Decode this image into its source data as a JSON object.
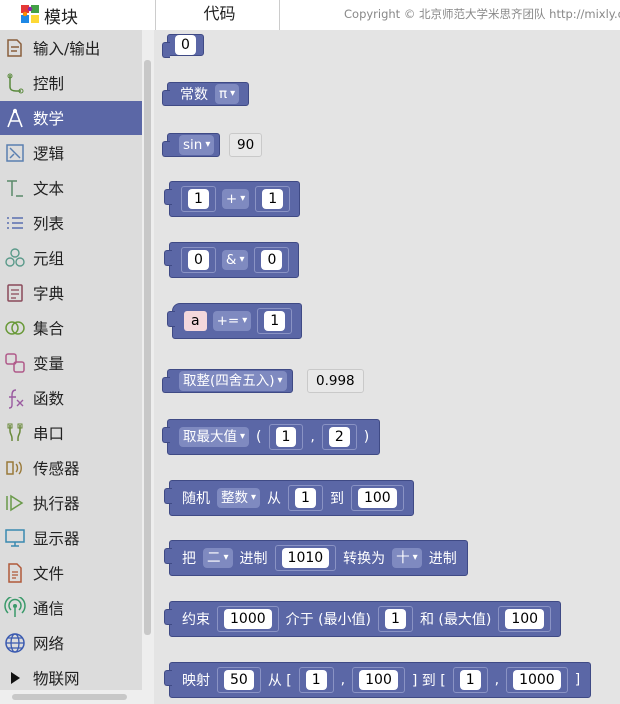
{
  "header": {
    "toolbox_title": "模块",
    "code_tab": "代码",
    "copyright": "Copyright © 北京师范大学米思齐团队 http://mixly.org"
  },
  "sidebar": {
    "items": [
      {
        "label": "输入/输出",
        "icon": "io-icon",
        "color": "#8a5e3c"
      },
      {
        "label": "控制",
        "icon": "control-icon",
        "color": "#5a8a3c"
      },
      {
        "label": "数学",
        "icon": "math-icon",
        "color": "#ffffff",
        "selected": true
      },
      {
        "label": "逻辑",
        "icon": "logic-icon",
        "color": "#5a7fb0"
      },
      {
        "label": "文本",
        "icon": "text-icon",
        "color": "#5a8a6a"
      },
      {
        "label": "列表",
        "icon": "list-icon",
        "color": "#5a6fb0"
      },
      {
        "label": "元组",
        "icon": "tuple-icon",
        "color": "#5a9a8a"
      },
      {
        "label": "字典",
        "icon": "dict-icon",
        "color": "#8a4a5a"
      },
      {
        "label": "集合",
        "icon": "set-icon",
        "color": "#6a9a3a"
      },
      {
        "label": "变量",
        "icon": "variable-icon",
        "color": "#b05a8a"
      },
      {
        "label": "函数",
        "icon": "function-icon",
        "color": "#9a5aa0"
      },
      {
        "label": "串口",
        "icon": "serial-icon",
        "color": "#6a8a3a"
      },
      {
        "label": "传感器",
        "icon": "sensor-icon",
        "color": "#9a7a3a"
      },
      {
        "label": "执行器",
        "icon": "actuator-icon",
        "color": "#6a9a4a"
      },
      {
        "label": "显示器",
        "icon": "display-icon",
        "color": "#3a8ab0"
      },
      {
        "label": "文件",
        "icon": "file-icon",
        "color": "#b05a3a"
      },
      {
        "label": "通信",
        "icon": "comm-icon",
        "color": "#3a9a6a"
      },
      {
        "label": "网络",
        "icon": "network-icon",
        "color": "#3a5ab0"
      },
      {
        "label": "物联网",
        "icon": "iot-icon",
        "color": "#111111"
      }
    ]
  },
  "blocks": {
    "number": {
      "value": "0"
    },
    "constant": {
      "label": "常数",
      "option": "π"
    },
    "trig": {
      "func": "sin",
      "value": "90"
    },
    "arith": {
      "a": "1",
      "op": "+",
      "b": "1"
    },
    "bitwise": {
      "a": "0",
      "op": "&",
      "b": "0"
    },
    "assign": {
      "var": "a",
      "op": "+=",
      "value": "1"
    },
    "round": {
      "func": "取整(四舍五入)",
      "value": "0.998"
    },
    "maxmin": {
      "func": "取最大值",
      "open": "(",
      "a": "1",
      "comma": ",",
      "b": "2",
      "close": ")"
    },
    "random": {
      "label": "随机",
      "type": "整数",
      "from": "从",
      "a": "1",
      "to": "到",
      "b": "100"
    },
    "radix": {
      "label": "把",
      "from_base": "二",
      "jinzhi1": "进制",
      "value": "1010",
      "convert": "转换为",
      "to_base": "十",
      "jinzhi2": "进制"
    },
    "constrain": {
      "label": "约束",
      "value": "1000",
      "between": "介于 (最小值)",
      "min": "1",
      "and": "和 (最大值)",
      "max": "100"
    },
    "map": {
      "label": "映射",
      "value": "50",
      "from": "从 [",
      "a1": "1",
      "comma1": ",",
      "a2": "100",
      "to": "] 到 [",
      "b1": "1",
      "comma2": ",",
      "b2": "1000",
      "close": "]"
    }
  },
  "colors": {
    "block": "#5b67a6",
    "sidebar_bg": "#dcdcdc",
    "workspace_bg": "#e4e4e4",
    "selected": "#5b67a6"
  }
}
